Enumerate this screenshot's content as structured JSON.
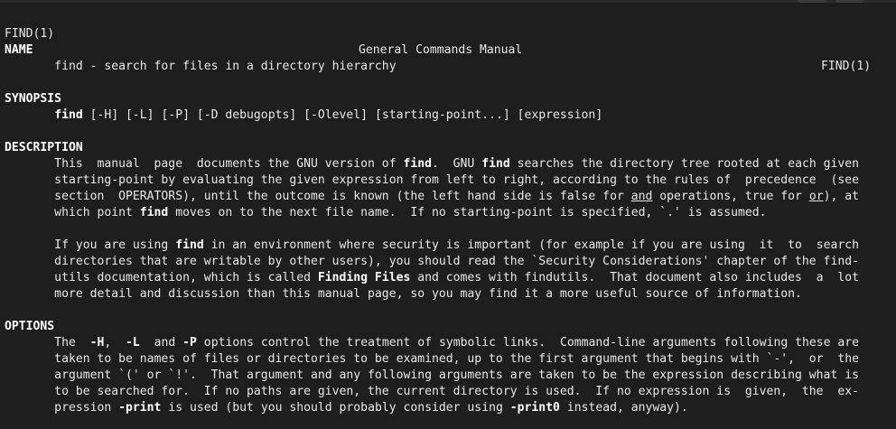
{
  "header": {
    "left": "FIND(1)",
    "center": "General Commands Manual",
    "right": "FIND(1)"
  },
  "sections": {
    "name": {
      "heading": "NAME",
      "lines": [
        [
          {
            "t": "       find - search for files in a directory hierarchy"
          }
        ]
      ]
    },
    "synopsis": {
      "heading": "SYNOPSIS",
      "lines": [
        [
          {
            "t": "       "
          },
          {
            "t": "find",
            "b": true
          },
          {
            "t": " [-H] [-L] [-P] [-D debugopts] [-Olevel] [starting-point...] [expression]"
          }
        ]
      ]
    },
    "description": {
      "heading": "DESCRIPTION",
      "lines": [
        [
          {
            "t": "       This  manual  page  documents the GNU version of "
          },
          {
            "t": "find",
            "b": true
          },
          {
            "t": ".  GNU "
          },
          {
            "t": "find",
            "b": true
          },
          {
            "t": " searches the directory tree rooted at each given"
          }
        ],
        [
          {
            "t": "       starting-point by evaluating the given expression from left to right, according to the rules of  precedence  (see"
          }
        ],
        [
          {
            "t": "       section  OPERATORS), until the outcome is known (the left hand side is false for "
          },
          {
            "t": "and",
            "u": true
          },
          {
            "t": " operations, true for "
          },
          {
            "t": "or",
            "u": true
          },
          {
            "t": "), at"
          }
        ],
        [
          {
            "t": "       which point "
          },
          {
            "t": "find",
            "b": true
          },
          {
            "t": " moves on to the next file name.  If no starting-point is specified, `.' is assumed."
          }
        ],
        [
          {
            "t": ""
          }
        ],
        [
          {
            "t": "       If you are using "
          },
          {
            "t": "find",
            "b": true
          },
          {
            "t": " in an environment where security is important (for example if you are using  it  to  search"
          }
        ],
        [
          {
            "t": "       directories that are writable by other users), you should read the `Security Considerations' chapter of the find-"
          }
        ],
        [
          {
            "t": "       utils documentation, which is called "
          },
          {
            "t": "Finding Files",
            "b": true
          },
          {
            "t": " and comes with findutils.  That document also includes  a  lot"
          }
        ],
        [
          {
            "t": "       more detail and discussion than this manual page, so you may find it a more useful source of information."
          }
        ]
      ]
    },
    "options": {
      "heading": "OPTIONS",
      "lines": [
        [
          {
            "t": "       The  "
          },
          {
            "t": "-H",
            "b": true
          },
          {
            "t": ",  "
          },
          {
            "t": "-L",
            "b": true
          },
          {
            "t": "  and "
          },
          {
            "t": "-P",
            "b": true
          },
          {
            "t": " options control the treatment of symbolic links.  Command-line arguments following these are"
          }
        ],
        [
          {
            "t": "       taken to be names of files or directories to be examined, up to the first argument that begins with `-',  or  the"
          }
        ],
        [
          {
            "t": "       argument `(' or `!'.  That argument and any following arguments are taken to be the expression describing what is"
          }
        ],
        [
          {
            "t": "       to be searched for.  If no paths are given, the current directory is used.  If no expression is  given,  the  ex-"
          }
        ],
        [
          {
            "t": "       pression "
          },
          {
            "t": "-print",
            "b": true
          },
          {
            "t": " is used (but you should probably consider using "
          },
          {
            "t": "-print0",
            "b": true
          },
          {
            "t": " instead, anyway)."
          }
        ]
      ]
    }
  }
}
